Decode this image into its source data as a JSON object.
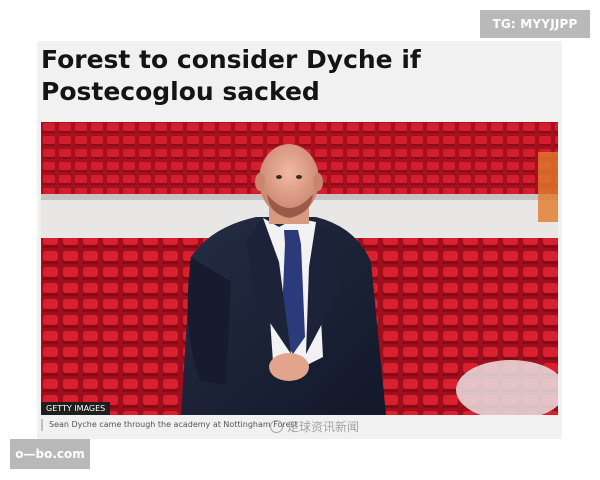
{
  "watermarks": {
    "telegram": "TG: MYYJJPP",
    "site": "o—bo.com",
    "social": "足球资讯新闻"
  },
  "article": {
    "headline": "Forest to consider Dyche if Postecoglou sacked",
    "image": {
      "credit": "GETTY IMAGES",
      "caption": "Sean Dyche came through the academy at Nottingham Forest"
    }
  },
  "colors": {
    "seat_red": "#c8182a",
    "suit_navy": "#1b2236",
    "tie_blue": "#2a3a7a",
    "card_bg": "#f1f1f1",
    "headline": "#141414"
  }
}
